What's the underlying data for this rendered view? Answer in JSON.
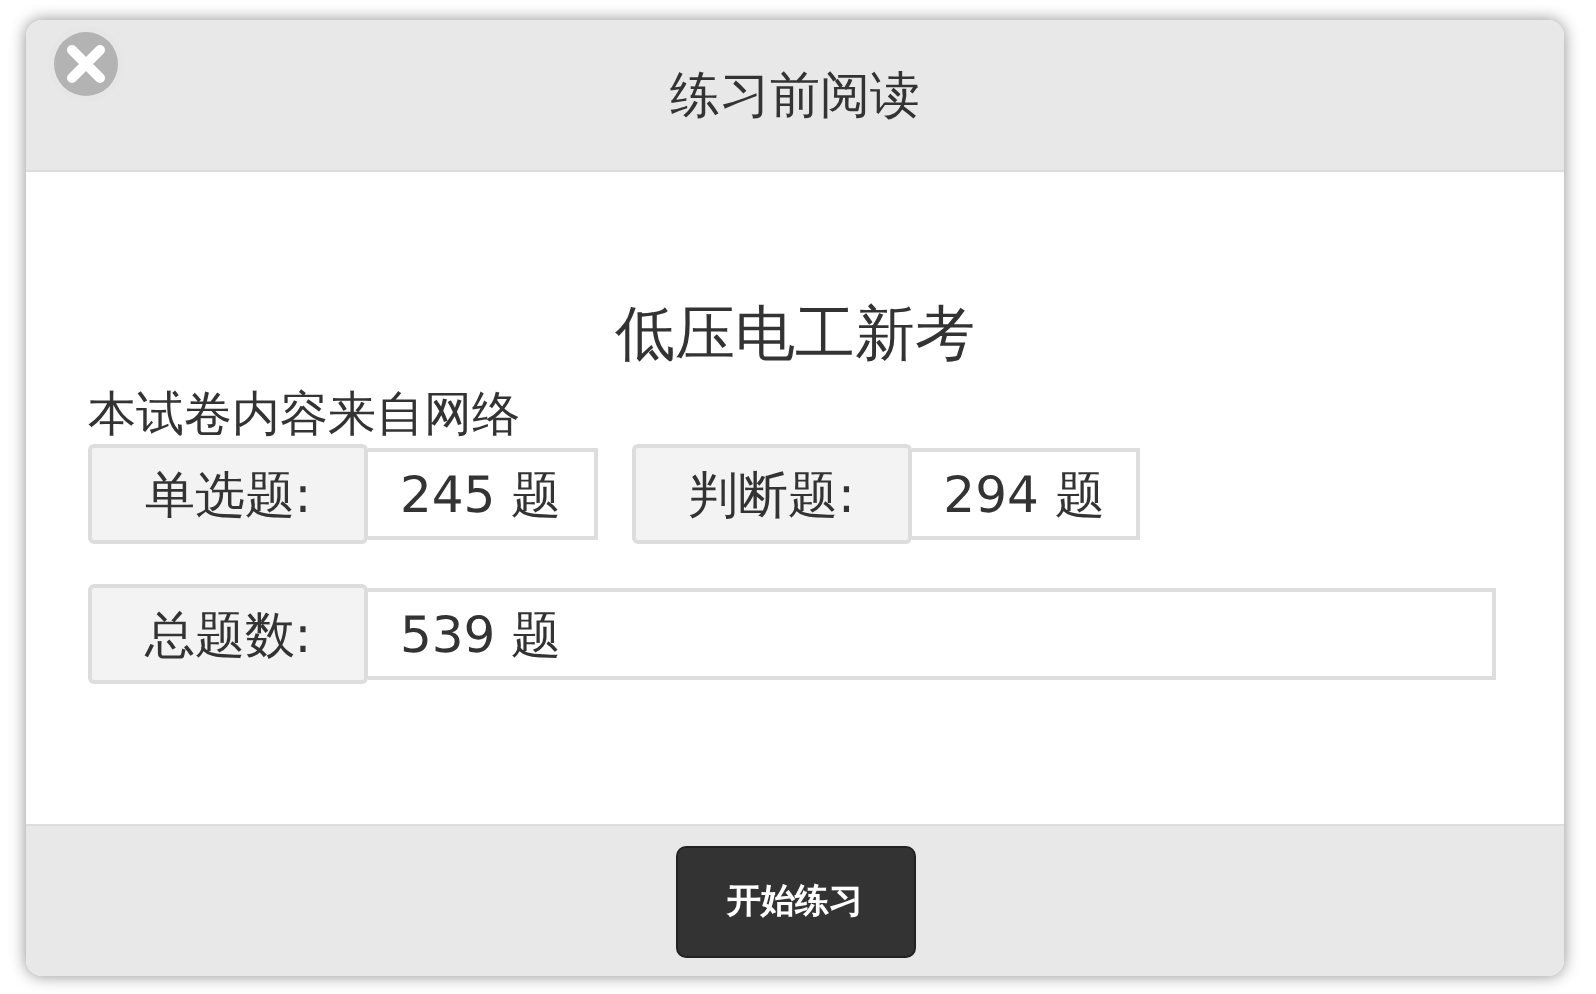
{
  "dialog": {
    "title": "练习前阅读"
  },
  "exam": {
    "title": "低压电工新考",
    "source": "本试卷内容来自网络"
  },
  "stats": [
    {
      "label": "单选题:",
      "value": "245 题",
      "kind": "short"
    },
    {
      "label": "判断题:",
      "value": "294 题",
      "kind": "short"
    },
    {
      "label": "总题数:",
      "value": "539 题",
      "kind": "wide"
    }
  ],
  "buttons": [
    "开始练习"
  ]
}
